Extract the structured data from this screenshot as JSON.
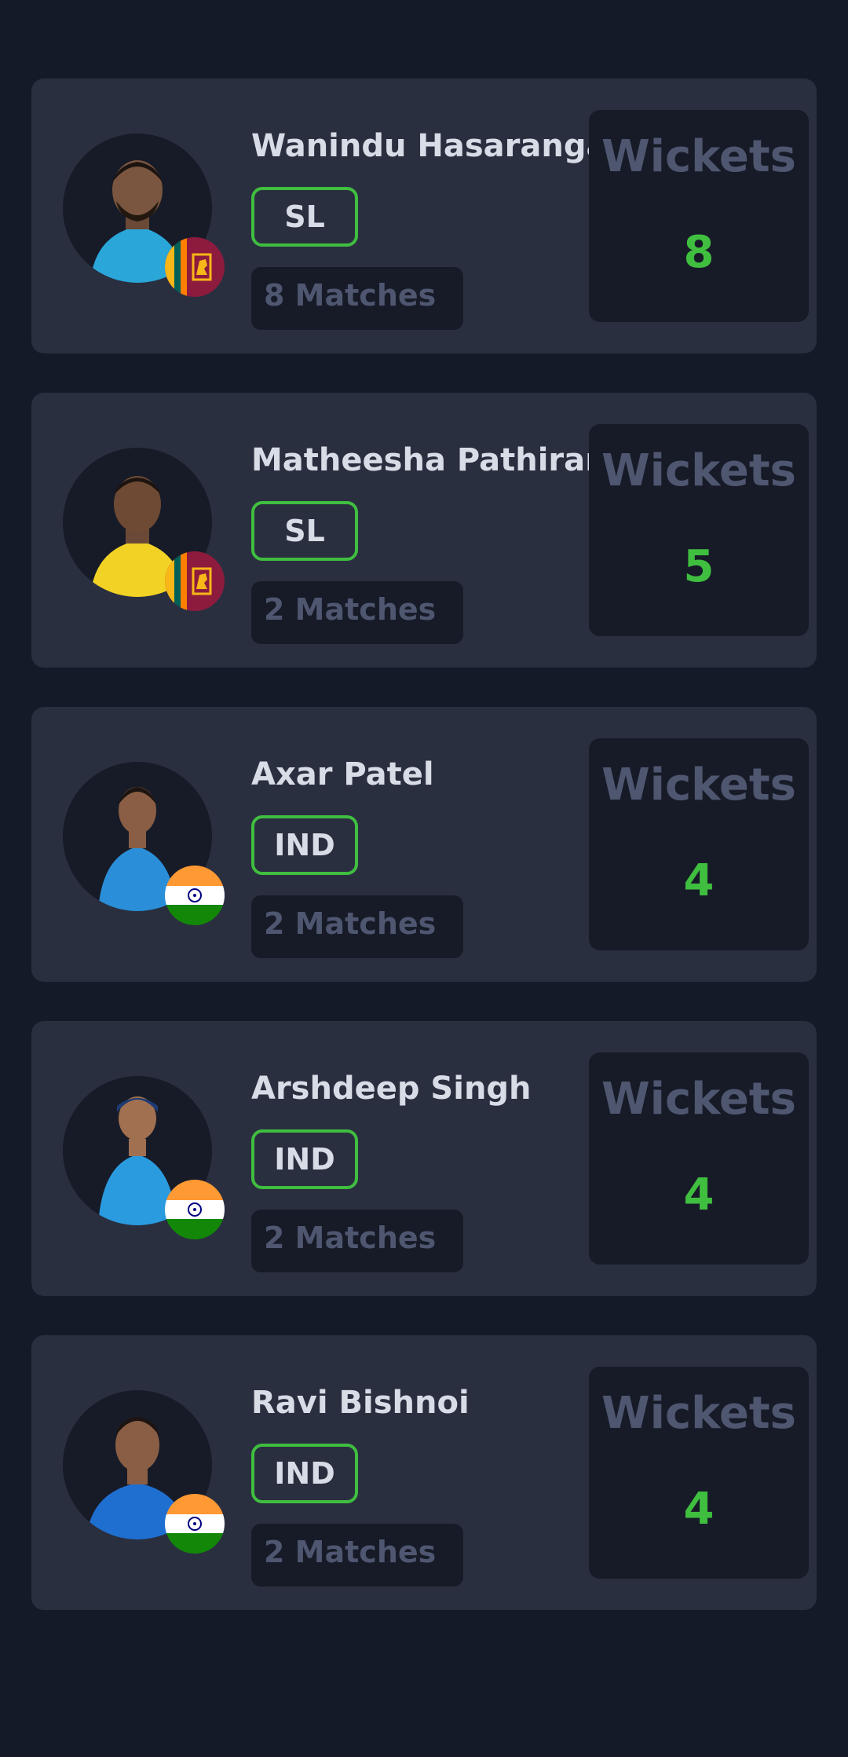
{
  "players": [
    {
      "name": "Wanindu Hasaranga",
      "country": "SL",
      "matches": "8 Matches",
      "stat_label": "Wickets",
      "stat_value": "8",
      "flag": "sri-lanka-flag",
      "jersey_color": "#2aa6d8"
    },
    {
      "name": "Matheesha Pathirana",
      "country": "SL",
      "matches": "2 Matches",
      "stat_label": "Wickets",
      "stat_value": "5",
      "flag": "sri-lanka-flag",
      "jersey_color": "#f2d224"
    },
    {
      "name": "Axar Patel",
      "country": "IND",
      "matches": "2 Matches",
      "stat_label": "Wickets",
      "stat_value": "4",
      "flag": "india-flag",
      "jersey_color": "#2a8fd8"
    },
    {
      "name": "Arshdeep Singh",
      "country": "IND",
      "matches": "2 Matches",
      "stat_label": "Wickets",
      "stat_value": "4",
      "flag": "india-flag",
      "jersey_color": "#2b9be0"
    },
    {
      "name": "Ravi Bishnoi",
      "country": "IND",
      "matches": "2 Matches",
      "stat_label": "Wickets",
      "stat_value": "4",
      "flag": "india-flag",
      "jersey_color": "#1f6fd0"
    }
  ],
  "colors": {
    "background": "#151a28",
    "card": "#2a2f40",
    "accent_green": "#3fbe3f",
    "muted_text": "#4f5670",
    "primary_text": "#d8dce6"
  }
}
